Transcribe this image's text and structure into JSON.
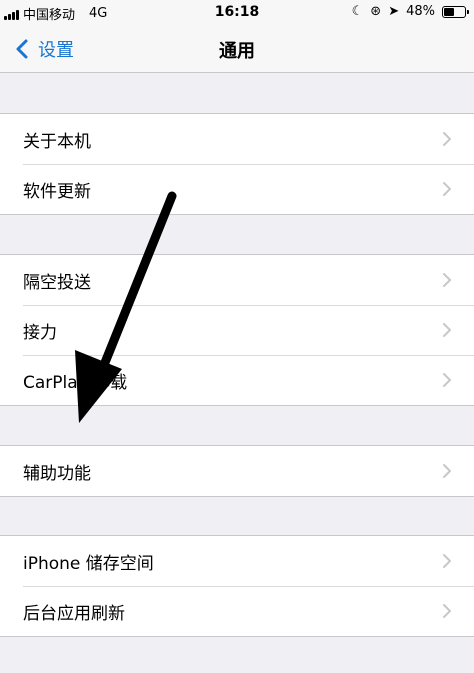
{
  "status_bar": {
    "carrier": "中国移动",
    "network": "4G",
    "time": "16:18",
    "battery": "48%",
    "battery_level": 0.48
  },
  "nav": {
    "back_label": "设置",
    "title": "通用"
  },
  "groups": [
    {
      "items": [
        {
          "label": "关于本机"
        },
        {
          "label": "软件更新"
        }
      ]
    },
    {
      "items": [
        {
          "label": "隔空投送"
        },
        {
          "label": "接力"
        },
        {
          "label": "CarPlay 车载"
        }
      ]
    },
    {
      "items": [
        {
          "label": "辅助功能"
        }
      ]
    },
    {
      "items": [
        {
          "label": "iPhone 储存空间"
        },
        {
          "label": "后台应用刷新"
        }
      ]
    }
  ],
  "colors": {
    "accent": "#1976d2",
    "background": "#efeff4",
    "chevron": "#c7c7cc",
    "arrow": "#000000"
  }
}
